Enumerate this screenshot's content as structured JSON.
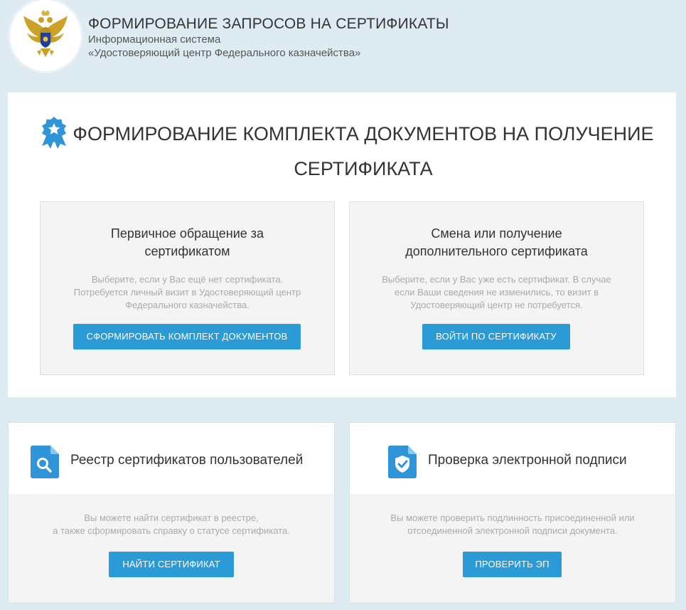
{
  "header": {
    "title": "ФОРМИРОВАНИЕ ЗАПРОСОВ НА СЕРТИФИКАТЫ",
    "subtitle_line1": "Информационная система",
    "subtitle_line2": "«Удостоверяющий центр Федерального казначейства»",
    "logo_icon": "double-headed-eagle-emblem"
  },
  "main": {
    "icon": "award-ribbon-icon",
    "title_line1": "ФОРМИРОВАНИЕ КОМПЛЕКТА ДОКУМЕНТОВ НА ПОЛУЧЕНИЕ",
    "title_line2": "СЕРТИФИКАТА",
    "options": [
      {
        "title_line1": "Первичное обращение за",
        "title_line2": "сертификатом",
        "desc_line1": "Выберите, если у Вас ещё нет сертификата.",
        "desc_line2": "Потребуется личный визит в Удостоверяющий центр",
        "desc_line3": "Федерального казначейства.",
        "button": "СФОРМИРОВАТЬ КОМПЛЕКТ ДОКУМЕНТОВ"
      },
      {
        "title_line1": "Смена или получение",
        "title_line2": "дополнительного сертификата",
        "desc_line1": "Выберите, если у Вас уже есть сертификат. В случае",
        "desc_line2": "если Ваши сведения не изменились, то визит в",
        "desc_line3": "Удостоверяющий центр не потребуется.",
        "button": "ВОЙТИ ПО СЕРТИФИКАТУ"
      }
    ]
  },
  "cards": [
    {
      "icon": "document-search-icon",
      "title": "Реестр сертификатов пользователей",
      "desc_line1": "Вы можете найти сертификат в реестре,",
      "desc_line2": "а также сформировать справку о статусе сертификата.",
      "button": "НАЙТИ СЕРТИФИКАТ"
    },
    {
      "icon": "document-shield-check-icon",
      "title": "Проверка электронной подписи",
      "desc_line1": "Вы можете проверить подлинность присоединенной или",
      "desc_line2": "отсоединенной электронной подписи документа.",
      "button": "ПРОВЕРИТЬ ЭП"
    }
  ],
  "colors": {
    "page_background": "#deebf3",
    "accent_button": "#2b9bd8",
    "icon_blue": "#2f95d8",
    "card_background": "#f4f4f4"
  }
}
